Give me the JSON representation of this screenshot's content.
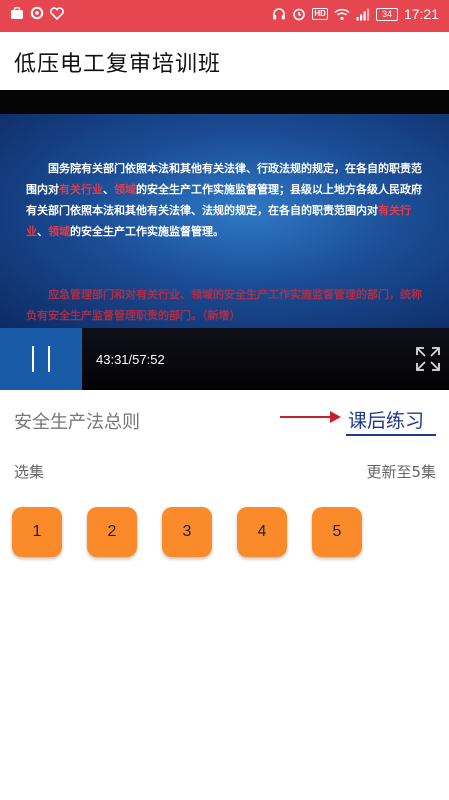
{
  "status_bar": {
    "time": "17:21",
    "battery": "34",
    "hd_badge": "HD",
    "colors": {
      "background": "#e64650"
    },
    "icons": [
      "briefcase-icon",
      "sync-icon",
      "heart-icon",
      "headset-icon",
      "alarm-icon",
      "hd-badge",
      "wifi-icon",
      "signal-icon",
      "battery-icon"
    ]
  },
  "app": {
    "title": "低压电工复审培训班"
  },
  "video": {
    "slide_paragraph_1_parts": [
      "国务院有关部门依照本法和其他有关法律、行政法规的规定，在各自的职责范围内对",
      "有关行业",
      "、",
      "领域",
      "的安全生产工作实施监督管理；县级以上地方各级人民政府有关部门依照本法和其他有关法律、法规的规定，在各自的职责范围内对",
      "有关行业",
      "、",
      "领域",
      "的安全生产工作实施监督管理。"
    ],
    "slide_paragraph_2": "应急管理部门和对有关行业、领域的安全生产工作实施监督管理的部门，统称负有安全生产监督管理职责的部门。（新增）",
    "time_display": "43:31/57:52",
    "colors": {
      "progress": "#1a5ba8",
      "highlight": "#e33b48"
    }
  },
  "course": {
    "title": "安全生产法总则",
    "exercise_link": "课后练习",
    "colors": {
      "link": "#1f3a8a",
      "arrow": "#c8202c"
    }
  },
  "episodes": {
    "label": "选集",
    "count_text": "更新至5集",
    "items": [
      "1",
      "2",
      "3",
      "4",
      "5"
    ],
    "colors": {
      "button": "#fb8a2a"
    }
  }
}
